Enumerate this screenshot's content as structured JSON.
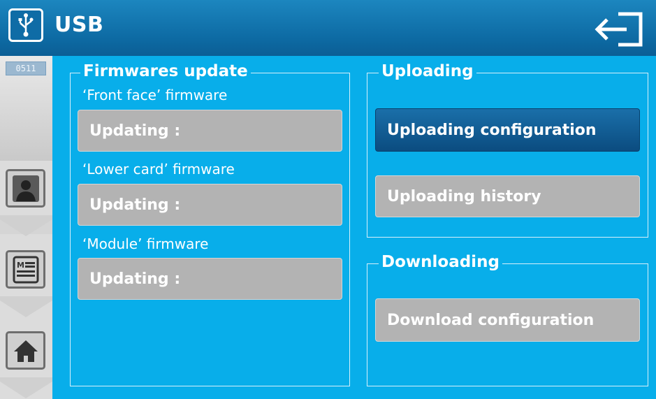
{
  "header": {
    "title": "USB"
  },
  "icons": {
    "usb": "usb-icon",
    "exit": "exit-icon",
    "profile": "user-icon",
    "menu": "menu-icon",
    "home": "home-icon"
  },
  "sidebar": {
    "counter": "0511"
  },
  "firmware": {
    "legend": "Firmwares update",
    "items": [
      {
        "label": "‘Front face’ firmware",
        "status": "Updating :"
      },
      {
        "label": "‘Lower card’ firmware",
        "status": "Updating :"
      },
      {
        "label": "‘Module’ firmware",
        "status": "Updating :"
      }
    ]
  },
  "uploading": {
    "legend": "Uploading",
    "config_label": "Uploading configuration",
    "history_label": "Uploading history"
  },
  "downloading": {
    "legend": "Downloading",
    "config_label": "Download configuration"
  },
  "colors": {
    "background": "#08aeea",
    "header": "#0d6aa3",
    "active_button": "#0b4c80",
    "idle_button": "#b3b3b3"
  }
}
